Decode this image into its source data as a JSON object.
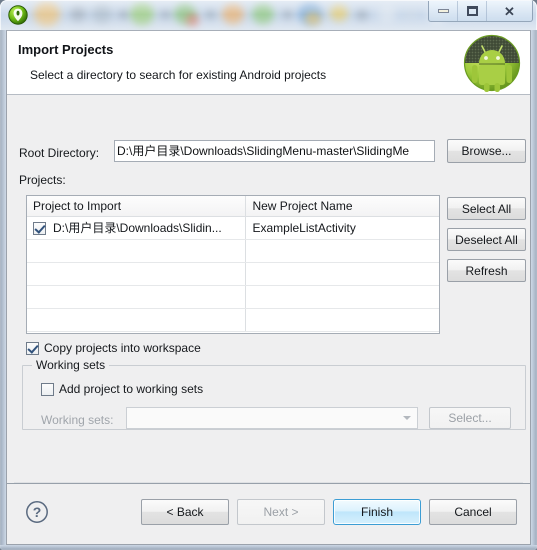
{
  "window": {
    "app_icon": "eclipse-icon",
    "controls": {
      "minimize": "minimize-icon",
      "restore": "restore-icon",
      "close": "close-icon",
      "close_glyph": "✕"
    }
  },
  "header": {
    "title": "Import Projects",
    "subtitle": "Select a directory to search for existing Android projects",
    "logo": "android-robot-icon"
  },
  "form": {
    "root_directory_label": "Root Directory:",
    "root_directory_value": "D:\\用户目录\\Downloads\\SlidingMenu-master\\SlidingMe",
    "root_directory_placeholder": "",
    "browse_label": "Browse...",
    "projects_label": "Projects:"
  },
  "table": {
    "columns": [
      "Project to Import",
      "New Project Name"
    ],
    "rows": [
      {
        "checked": true,
        "project_to_import": "D:\\用户目录\\Downloads\\Slidin...",
        "new_project_name": "ExampleListActivity"
      },
      {
        "checked": null,
        "project_to_import": "",
        "new_project_name": ""
      },
      {
        "checked": null,
        "project_to_import": "",
        "new_project_name": ""
      },
      {
        "checked": null,
        "project_to_import": "",
        "new_project_name": ""
      },
      {
        "checked": null,
        "project_to_import": "",
        "new_project_name": ""
      }
    ]
  },
  "side_buttons": {
    "select_all": "Select All",
    "deselect_all": "Deselect All",
    "refresh": "Refresh"
  },
  "options": {
    "copy_projects_label": "Copy projects into workspace",
    "copy_projects_checked": true
  },
  "working_sets": {
    "group_label": "Working sets",
    "add_label": "Add project to working sets",
    "add_checked": false,
    "combo_label": "Working sets:",
    "combo_value": "",
    "select_label": "Select...",
    "disabled": true
  },
  "footer": {
    "help": "help-icon",
    "back": "< Back",
    "next": "Next >",
    "finish": "Finish",
    "cancel": "Cancel",
    "next_disabled": true,
    "finish_is_default": true
  },
  "colors": {
    "default_button_border": "#3c9dd4",
    "dialog_background": "#efeff0",
    "header_background": "#ffffff",
    "android_green": "#a4c639"
  }
}
